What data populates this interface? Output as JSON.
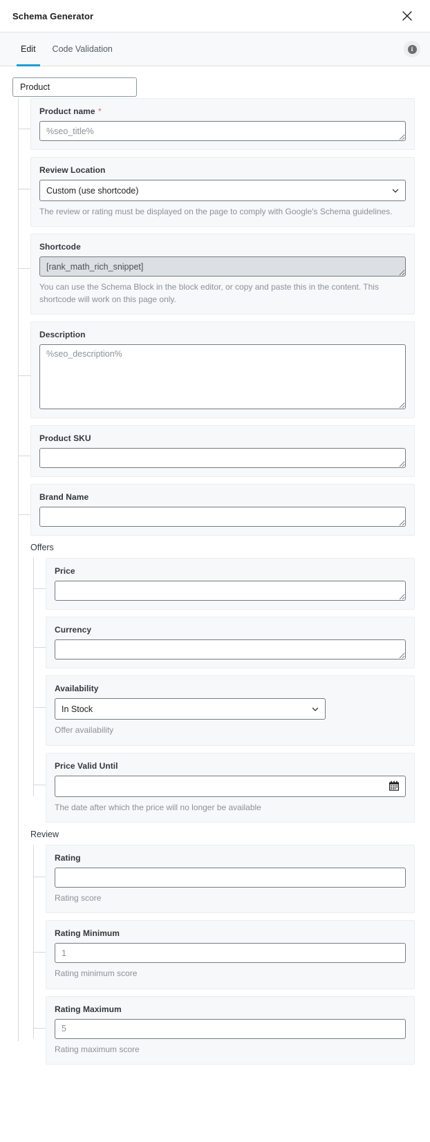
{
  "modal": {
    "title": "Schema Generator",
    "close_label": "Close"
  },
  "tabs": [
    {
      "label": "Edit",
      "active": true
    },
    {
      "label": "Code Validation",
      "active": false
    }
  ],
  "info_button": {
    "glyph": "i",
    "name": "info-icon"
  },
  "schema": {
    "root_type": "Product",
    "fields": [
      {
        "key": "product_name",
        "label": "Product name",
        "required": true,
        "control": "textarea",
        "value": "",
        "placeholder": "%seo_title%",
        "hint": ""
      },
      {
        "key": "review_location",
        "label": "Review Location",
        "required": false,
        "control": "select",
        "value": "Custom (use shortcode)",
        "options": [
          "Custom (use shortcode)"
        ],
        "hint": "The review or rating must be displayed on the page to comply with Google's Schema guidelines."
      },
      {
        "key": "shortcode",
        "label": "Shortcode",
        "required": false,
        "control": "textarea-readonly",
        "value": "",
        "placeholder": "[rank_math_rich_snippet]",
        "hint": "You can use the Schema Block in the block editor, or copy and paste this in the content. This shortcode will work on this page only."
      },
      {
        "key": "description",
        "label": "Description",
        "required": false,
        "control": "textarea-large",
        "value": "",
        "placeholder": "%seo_description%",
        "hint": ""
      },
      {
        "key": "product_sku",
        "label": "Product SKU",
        "required": false,
        "control": "textarea",
        "value": "",
        "placeholder": "",
        "hint": ""
      },
      {
        "key": "brand_name",
        "label": "Brand Name",
        "required": false,
        "control": "textarea",
        "value": "",
        "placeholder": "",
        "hint": ""
      }
    ],
    "groups": [
      {
        "key": "offers",
        "label": "Offers",
        "fields": [
          {
            "key": "price",
            "label": "Price",
            "control": "textarea",
            "value": "",
            "placeholder": "",
            "hint": ""
          },
          {
            "key": "currency",
            "label": "Currency",
            "control": "textarea",
            "value": "",
            "placeholder": "",
            "hint": ""
          },
          {
            "key": "availability",
            "label": "Availability",
            "control": "select",
            "value": "In Stock",
            "options": [
              "In Stock"
            ],
            "hint": "Offer availability"
          },
          {
            "key": "price_valid_until",
            "label": "Price Valid Until",
            "control": "date",
            "value": "",
            "placeholder": "",
            "hint": "The date after which the price will no longer be available"
          }
        ]
      },
      {
        "key": "review",
        "label": "Review",
        "fields": [
          {
            "key": "rating",
            "label": "Rating",
            "control": "input",
            "value": "",
            "placeholder": "",
            "hint": "Rating score"
          },
          {
            "key": "rating_minimum",
            "label": "Rating Minimum",
            "control": "input",
            "value": "",
            "placeholder": "1",
            "hint": "Rating minimum score"
          },
          {
            "key": "rating_maximum",
            "label": "Rating Maximum",
            "control": "input",
            "value": "",
            "placeholder": "5",
            "hint": "Rating maximum score"
          }
        ]
      }
    ]
  },
  "colors": {
    "accent": "#1d9bd1",
    "required": "#e06666",
    "card_bg": "#f7f8f9",
    "border": "#757b81",
    "hint": "#8b9197",
    "readonly_bg": "#dcdfe3"
  }
}
